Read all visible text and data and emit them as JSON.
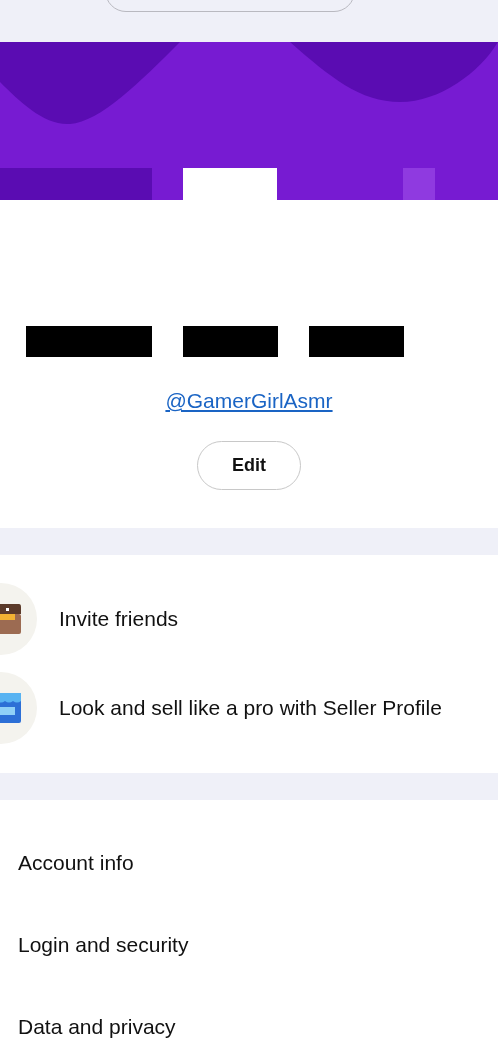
{
  "profile": {
    "handle": "@GamerGirlAsmr",
    "edit_button": "Edit"
  },
  "promos": [
    {
      "kind": "gift",
      "label": "Invite friends"
    },
    {
      "kind": "store",
      "label": "Look and sell like a pro with Seller Profile"
    }
  ],
  "settings": [
    {
      "label": "Account info"
    },
    {
      "label": "Login and security"
    },
    {
      "label": "Data and privacy"
    }
  ]
}
